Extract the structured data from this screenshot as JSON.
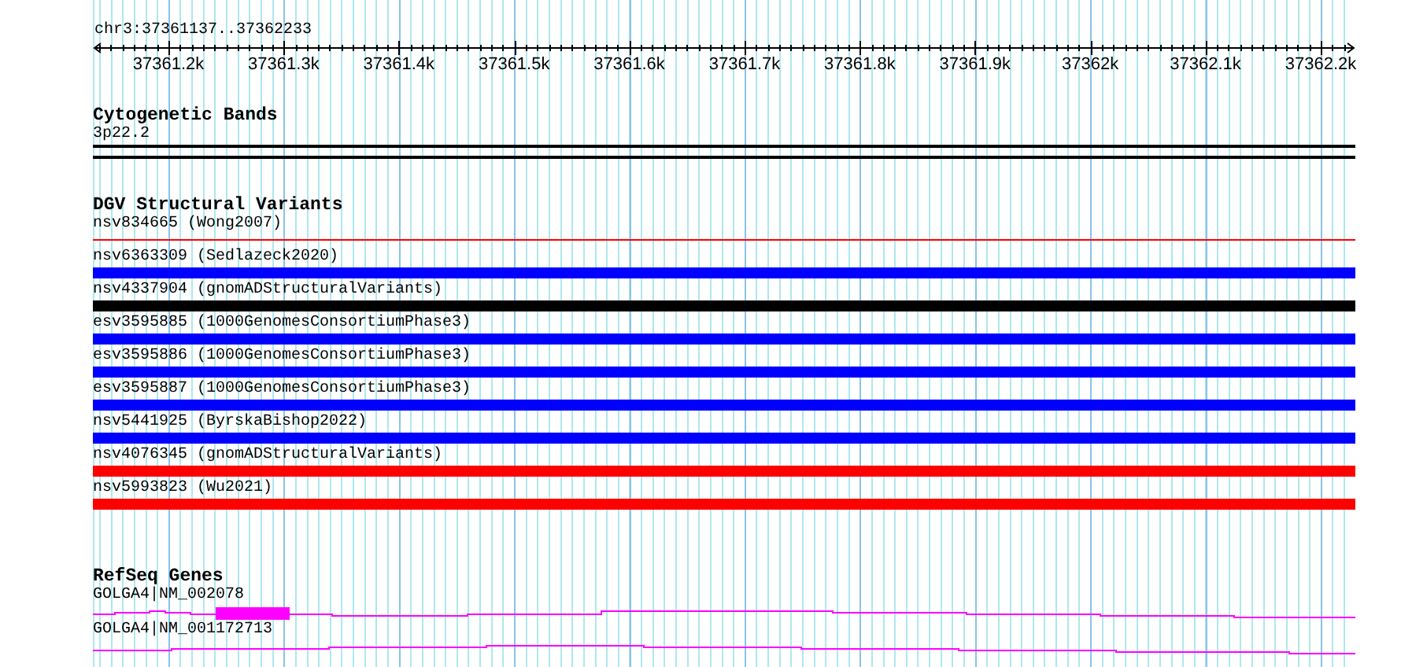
{
  "ruler": {
    "position": "chr3:37361137..37362233",
    "ticks": [
      "37361.2k",
      "37361.3k",
      "37361.4k",
      "37361.5k",
      "37361.6k",
      "37361.7k",
      "37361.8k",
      "37361.9k",
      "37362k",
      "37362.1k",
      "37362.2k"
    ]
  },
  "tracks": [
    {
      "kind": "bands",
      "title": "Cytogenetic Bands",
      "items": [
        {
          "label": "3p22.2"
        }
      ]
    },
    {
      "kind": "variants",
      "title": "DGV Structural Variants",
      "items": [
        {
          "label": "nsv834665 (Wong2007)",
          "color": "#ff0000",
          "kind": "line"
        },
        {
          "label": "nsv6363309 (Sedlazeck2020)",
          "color": "#0000ff",
          "kind": "bar"
        },
        {
          "label": "nsv4337904 (gnomADStructuralVariants)",
          "color": "#000000",
          "kind": "bar"
        },
        {
          "label": "esv3595885 (1000GenomesConsortiumPhase3)",
          "color": "#0000ff",
          "kind": "bar"
        },
        {
          "label": "esv3595886 (1000GenomesConsortiumPhase3)",
          "color": "#0000ff",
          "kind": "bar"
        },
        {
          "label": "esv3595887 (1000GenomesConsortiumPhase3)",
          "color": "#0000ff",
          "kind": "bar"
        },
        {
          "label": "nsv5441925 (ByrskaBishop2022)",
          "color": "#0000ff",
          "kind": "bar"
        },
        {
          "label": "nsv4076345 (gnomADStructuralVariants)",
          "color": "#ff0000",
          "kind": "bar"
        },
        {
          "label": "nsv5993823 (Wu2021)",
          "color": "#ff0000",
          "kind": "bar"
        }
      ]
    },
    {
      "kind": "genes",
      "title": "RefSeq Genes",
      "items": [
        {
          "label": "GOLGA4|NM_002078",
          "exon": true
        },
        {
          "label": "GOLGA4|NM_001172713",
          "exon": false
        }
      ]
    }
  ]
}
